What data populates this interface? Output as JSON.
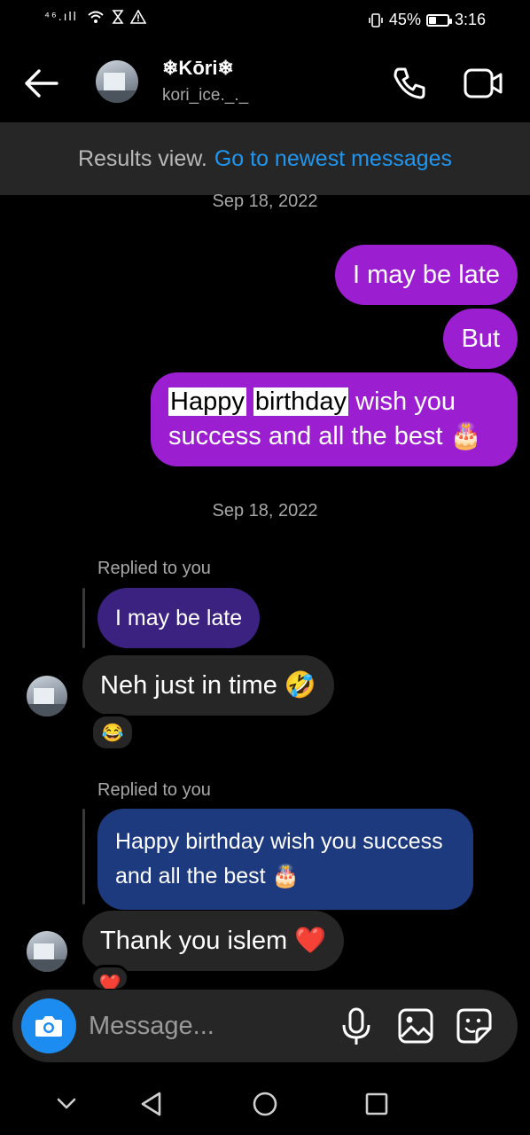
{
  "status": {
    "network": "⁴⁶.ıll",
    "battery_text": "45%",
    "battery_level": 0.45,
    "time": "3:16"
  },
  "header": {
    "name": "❄Kōri❄",
    "username": "kori_ice._._"
  },
  "banner": {
    "label": "Results view.",
    "link": "Go to newest messages"
  },
  "dates": [
    "Sep 18, 2022",
    "Sep 18, 2022"
  ],
  "sent": {
    "m1": "I may be late",
    "m2": "But",
    "m3_h1": "Happy",
    "m3_h2": "birthday",
    "m3_rest": " wish you success and all the best 🎂"
  },
  "received": {
    "replied_label": "Replied to you",
    "quote1": "I may be late",
    "msg1": "Neh just in time 🤣",
    "reaction1": "😂",
    "quote2": "Happy birthday wish you success and all the best 🎂",
    "msg2": "Thank you islem ❤️",
    "reaction2": "❤️"
  },
  "composer": {
    "placeholder": "Message..."
  },
  "colors": {
    "sent_bubble": "#9b1ed0",
    "received_bubble": "#262626",
    "link": "#1f96f0",
    "camera_button": "#1d8cf0"
  }
}
